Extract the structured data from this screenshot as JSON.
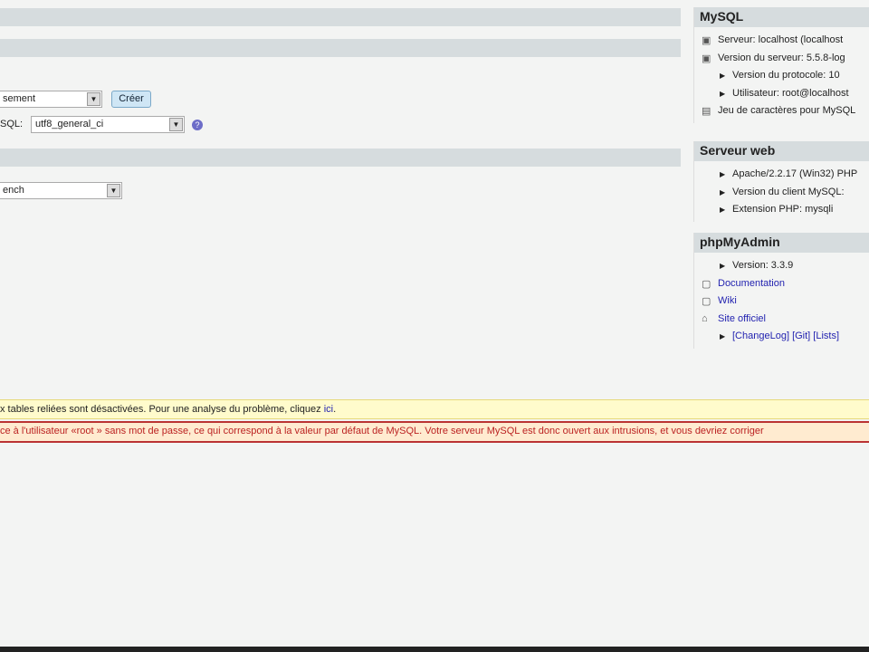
{
  "main": {
    "create_db": {
      "collation_value": "sement",
      "create_button": "Créer"
    },
    "collation_conn": {
      "label": "SQL:",
      "value": "utf8_general_ci",
      "help_icon": "help-icon"
    },
    "theme": {
      "value": "ench"
    }
  },
  "mysql": {
    "title": "MySQL",
    "items": [
      {
        "icon": "server-icon",
        "text": "Serveur: localhost (localhost"
      },
      {
        "icon": "server-icon",
        "text": "Version du serveur: 5.5.8-log"
      },
      {
        "icon": "bullet",
        "text": "Version du protocole: 10"
      },
      {
        "icon": "bullet",
        "text": "Utilisateur: root@localhost"
      },
      {
        "icon": "charset-icon",
        "text": "Jeu de caractères pour MySQL"
      }
    ]
  },
  "webserver": {
    "title": "Serveur web",
    "items": [
      "Apache/2.2.17 (Win32) PHP",
      "Version du client MySQL:",
      "Extension PHP: mysqli"
    ]
  },
  "pma": {
    "title": "phpMyAdmin",
    "version": "Version: 3.3.9",
    "documentation": "Documentation",
    "wiki": "Wiki",
    "site": "Site officiel",
    "changelog": "[ChangeLog]",
    "git": "[Git]",
    "lists": "[Lists]"
  },
  "notice": {
    "text": "x tables reliées sont désactivées. Pour une analyse du problème, cliquez ",
    "link": "ici",
    "end": "."
  },
  "error": {
    "text": "ce à l'utilisateur «root » sans mot de passe, ce qui correspond à la valeur par défaut de MySQL. Votre serveur MySQL est donc ouvert aux intrusions, et vous devriez corriger"
  }
}
